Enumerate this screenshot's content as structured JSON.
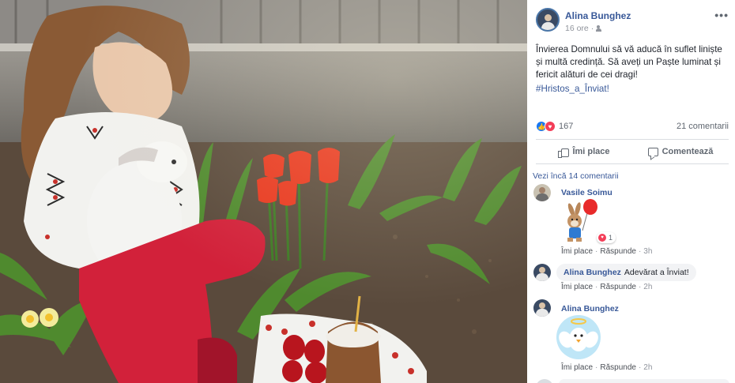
{
  "post": {
    "author": "Alina Bunghez",
    "time": "16 ore",
    "separator": "·",
    "privacy_icon": "friends-icon",
    "more_icon": "•••",
    "text": "Învierea Domnului să vă aducă în suflet liniște și multă credință. Să aveți un Paște luminat și fericit alături de cei dragi!",
    "hashtag": "#Hristos_a_Înviat!",
    "reaction_count": "167",
    "comment_count": "21 comentarii",
    "reaction_icons": [
      "like-icon",
      "love-icon"
    ]
  },
  "actions": {
    "like_label": "Îmi place",
    "comment_label": "Comentează"
  },
  "comments": {
    "view_more": "Vezi încă 14 comentarii",
    "items": [
      {
        "author": "Vasile Soimu",
        "text": "",
        "sticker": "bunny-balloon-sticker",
        "reaction_count": "1",
        "like": "Îmi place",
        "reply": "Răspunde",
        "dot": "·",
        "time": "3h"
      },
      {
        "author": "Alina Bunghez",
        "text": "Adevărat a Înviat!",
        "like": "Îmi place",
        "reply": "Răspunde",
        "dot": "·",
        "time": "2h"
      },
      {
        "author": "Alina Bunghez",
        "text": "",
        "sticker": "angel-bird-sticker",
        "like": "Îmi place",
        "reply": "Răspunde",
        "dot": "·",
        "time": "2h"
      }
    ]
  },
  "colors": {
    "link": "#385898",
    "muted": "#90949c",
    "like_blue": "#1877f2",
    "love_red": "#f33e58"
  }
}
